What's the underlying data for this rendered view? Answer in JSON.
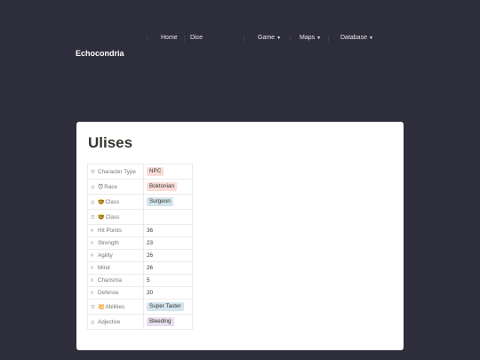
{
  "site": {
    "brand": "Echocondria",
    "nav": [
      {
        "label": "Home",
        "dropdown": false
      },
      {
        "label": "Dice",
        "dropdown": false
      },
      {
        "label": "Game",
        "dropdown": true
      },
      {
        "label": "Maps",
        "dropdown": true
      },
      {
        "label": "Database",
        "dropdown": true
      }
    ]
  },
  "page": {
    "title": "Ulises",
    "properties": [
      {
        "icon": "list-icon",
        "icon_glyph": "☰",
        "label": "Character Type",
        "value": "NPC",
        "tag_color": "#fadcd9"
      },
      {
        "icon": "select-icon",
        "icon_glyph": "◎",
        "emoji": "😈",
        "label": "Race",
        "value": "Boktonian",
        "tag_color": "#fadcd9"
      },
      {
        "icon": "select-icon",
        "icon_glyph": "◎",
        "emoji": "🤓",
        "label": "Class",
        "value": "Surgeon",
        "tag_color": "#d3e5ef"
      },
      {
        "icon": "list-icon",
        "icon_glyph": "☰",
        "emoji": "🤓",
        "label": "Class",
        "value": ""
      },
      {
        "icon": "number-icon",
        "icon_glyph": "#",
        "label": "Hit Points",
        "value": "36"
      },
      {
        "icon": "number-icon",
        "icon_glyph": "#",
        "label": "Strength",
        "value": "23"
      },
      {
        "icon": "number-icon",
        "icon_glyph": "#",
        "label": "Agility",
        "value": "26"
      },
      {
        "icon": "number-icon",
        "icon_glyph": "#",
        "label": "Mind",
        "value": "26"
      },
      {
        "icon": "number-icon",
        "icon_glyph": "#",
        "label": "Charisma",
        "value": "5"
      },
      {
        "icon": "number-icon",
        "icon_glyph": "#",
        "label": "Defense",
        "value": "20"
      },
      {
        "icon": "list-icon",
        "icon_glyph": "☰",
        "emoji": "💥",
        "label": "Abilities",
        "value": "Super Taster",
        "tag_color": "#d3e5ef"
      },
      {
        "icon": "select-icon",
        "icon_glyph": "◎",
        "label": "Adjective",
        "value": "Bleeding",
        "tag_color": "#e8deee"
      }
    ]
  },
  "colors": {
    "background": "#2e2d3b",
    "card": "#ffffff",
    "text": "#37352f"
  }
}
